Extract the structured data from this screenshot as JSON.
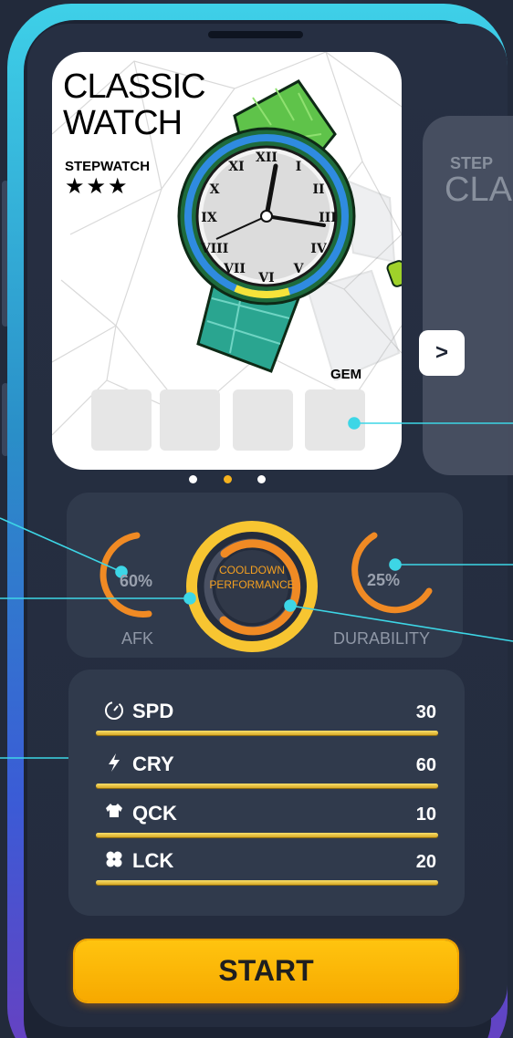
{
  "watch_card": {
    "title": "CLASSIC\nWATCH",
    "brand": "STEPWATCH",
    "stars": "★★★",
    "gem_label": "GEM",
    "gem_slots": 4
  },
  "next_card": {
    "brand": "STEP",
    "title": "CLA"
  },
  "next_button": {
    "label": ">"
  },
  "pager": {
    "count": 3,
    "active_index": 1
  },
  "gauges": {
    "afk": {
      "label": "AFK",
      "value": "60%",
      "level": 0.6
    },
    "center": {
      "line1": "COOLDOWN",
      "line2": "PERFORMANCE"
    },
    "durability": {
      "label": "DURABILITY",
      "value": "25%",
      "level": 0.25
    }
  },
  "attributes": [
    {
      "icon": "stopwatch-icon",
      "name": "SPD",
      "value": "30"
    },
    {
      "icon": "lightning-icon",
      "name": "CRY",
      "value": "60"
    },
    {
      "icon": "shirt-icon",
      "name": "QCK",
      "value": "10"
    },
    {
      "icon": "clover-icon",
      "name": "LCK",
      "value": "20"
    }
  ],
  "start_button": {
    "label": "START"
  },
  "colors": {
    "accent_orange": "#f08a24",
    "accent_yellow": "#f7c531",
    "callout_cyan": "#3dd6e6",
    "start_button": "#ffbe0a",
    "panel": "#303a4c"
  }
}
